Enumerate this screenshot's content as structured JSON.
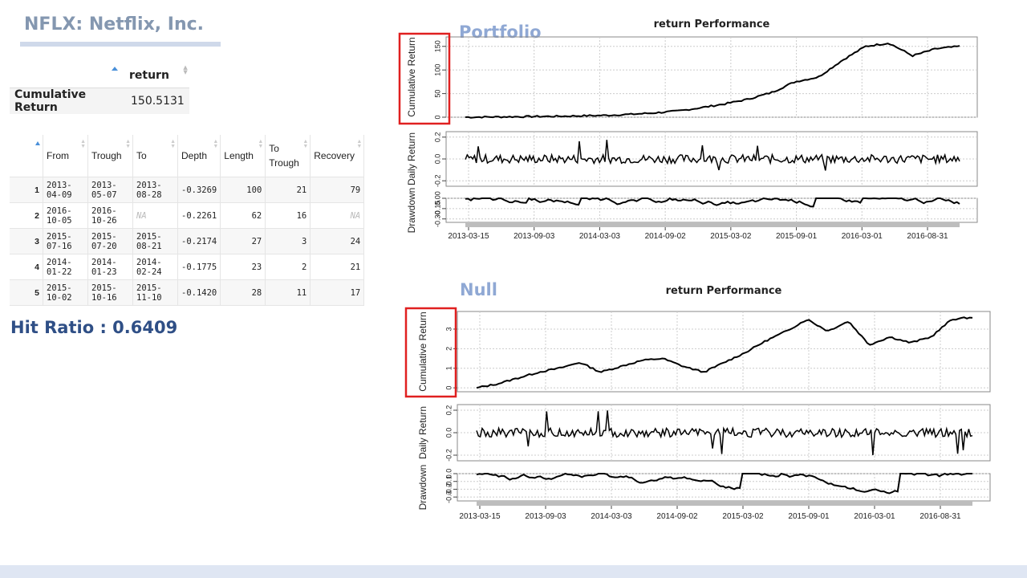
{
  "header": {
    "title": "NFLX: Netflix, Inc."
  },
  "summary_table": {
    "column": "return",
    "row_label": "Cumulative Return",
    "value": "150.5131"
  },
  "drawdown_table": {
    "columns": [
      "From",
      "Trough",
      "To",
      "Depth",
      "Length",
      "To Trough",
      "Recovery"
    ],
    "rows": [
      {
        "idx": "1",
        "from": "2013-04-09",
        "trough": "2013-05-07",
        "to": "2013-08-28",
        "depth": "-0.3269",
        "length": "100",
        "to_trough": "21",
        "recovery": "79"
      },
      {
        "idx": "2",
        "from": "2016-10-05",
        "trough": "2016-10-26",
        "to": "NA",
        "depth": "-0.2261",
        "length": "62",
        "to_trough": "16",
        "recovery": "NA"
      },
      {
        "idx": "3",
        "from": "2015-07-16",
        "trough": "2015-07-20",
        "to": "2015-08-21",
        "depth": "-0.2174",
        "length": "27",
        "to_trough": "3",
        "recovery": "24"
      },
      {
        "idx": "4",
        "from": "2014-01-22",
        "trough": "2014-01-23",
        "to": "2014-02-24",
        "depth": "-0.1775",
        "length": "23",
        "to_trough": "2",
        "recovery": "21"
      },
      {
        "idx": "5",
        "from": "2015-10-02",
        "trough": "2015-10-16",
        "to": "2015-11-10",
        "depth": "-0.1420",
        "length": "28",
        "to_trough": "11",
        "recovery": "17"
      }
    ]
  },
  "hit_ratio": "Hit Ratio : 0.6409",
  "sections": {
    "portfolio": "Portfolio",
    "null": "Null"
  },
  "colors": {
    "highlight_box": "#e02020",
    "series": "#000000",
    "title_blue": "#8497b0"
  },
  "chart_data": [
    {
      "type": "line",
      "title": "return Performance",
      "panels": [
        {
          "ylabel": "Cumulative Return",
          "yticks": [
            "0",
            "50",
            "100",
            "150"
          ],
          "ylim": [
            0,
            170
          ]
        },
        {
          "ylabel": "Daily Return",
          "yticks": [
            "-0.2",
            "0.0",
            "0.2"
          ],
          "ylim": [
            -0.25,
            0.25
          ]
        },
        {
          "ylabel": "Drawdown",
          "yticks": [
            "-0.30",
            "-0.15",
            "0.00"
          ],
          "ylim": [
            -0.35,
            0.0
          ]
        }
      ],
      "x_ticks": [
        "2013-03-15",
        "2013-09-03",
        "2014-03-03",
        "2014-09-02",
        "2015-03-02",
        "2015-09-01",
        "2016-03-01",
        "2016-08-31"
      ],
      "series": [
        {
          "values": [
            0,
            0.5,
            1,
            1.5,
            2,
            3,
            4,
            6,
            9,
            13,
            20,
            28,
            38,
            52,
            75,
            85,
            120,
            150,
            157,
            130,
            145,
            150
          ]
        }
      ]
    },
    {
      "type": "line",
      "title": "return Performance",
      "panels": [
        {
          "ylabel": "Cumulative Return",
          "yticks": [
            "0",
            "1",
            "2",
            "3"
          ],
          "ylim": [
            -0.2,
            3.9
          ]
        },
        {
          "ylabel": "Daily Return",
          "yticks": [
            "-0.2",
            "0.0",
            "0.2"
          ],
          "ylim": [
            -0.25,
            0.25
          ]
        },
        {
          "ylabel": "Drawdown",
          "yticks": [
            "-0.3",
            "-0.2",
            "-0.1",
            "0.0"
          ],
          "ylim": [
            -0.35,
            0.0
          ]
        }
      ],
      "x_ticks": [
        "2013-03-15",
        "2013-09-03",
        "2014-03-03",
        "2014-09-02",
        "2015-03-02",
        "2015-09-01",
        "2016-03-01",
        "2016-08-31"
      ],
      "series": [
        {
          "values": [
            0,
            0.2,
            0.5,
            0.8,
            1.0,
            1.3,
            0.8,
            1.1,
            1.4,
            1.5,
            1.1,
            0.8,
            1.3,
            1.8,
            2.4,
            2.9,
            3.5,
            2.9,
            3.4,
            2.2,
            2.6,
            2.3,
            2.6,
            3.5,
            3.6
          ]
        }
      ]
    }
  ]
}
